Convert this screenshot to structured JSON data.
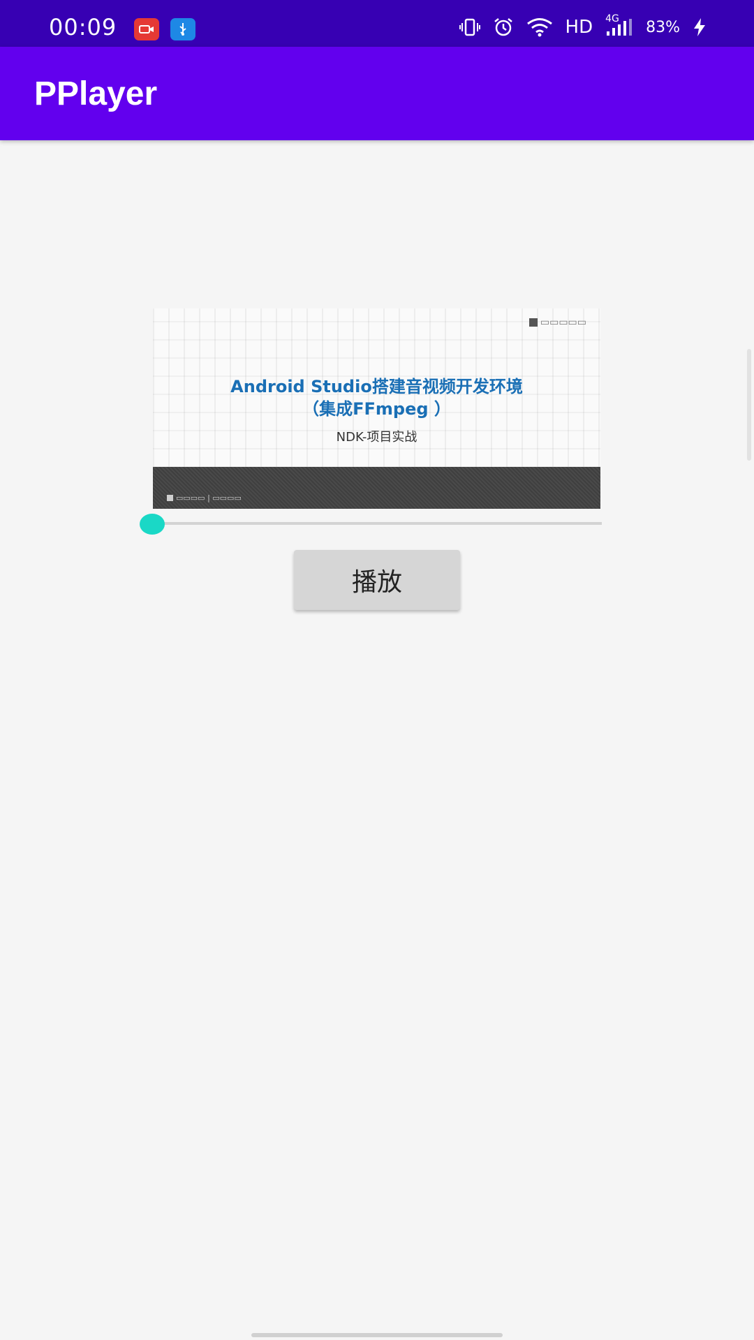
{
  "status_bar": {
    "time": "00:09",
    "notification_icons": [
      "screen-record-icon",
      "usb-icon"
    ],
    "network_label": "HD",
    "signal_label": "4G",
    "battery_percent": "83%",
    "icons": [
      "vibrate-icon",
      "alarm-icon",
      "wifi-icon",
      "signal-icon",
      "battery-charging-icon"
    ]
  },
  "app_bar": {
    "title": "PPlayer",
    "color": "#6200ee"
  },
  "video": {
    "title_line1": "Android Studio搭建音视频开发环境",
    "title_line2": "（集成FFmpeg ）",
    "subtitle": "NDK-项目实战"
  },
  "seek_bar": {
    "progress": 0,
    "accent_color": "#1ad8c6"
  },
  "play_button": {
    "label": "播放"
  }
}
